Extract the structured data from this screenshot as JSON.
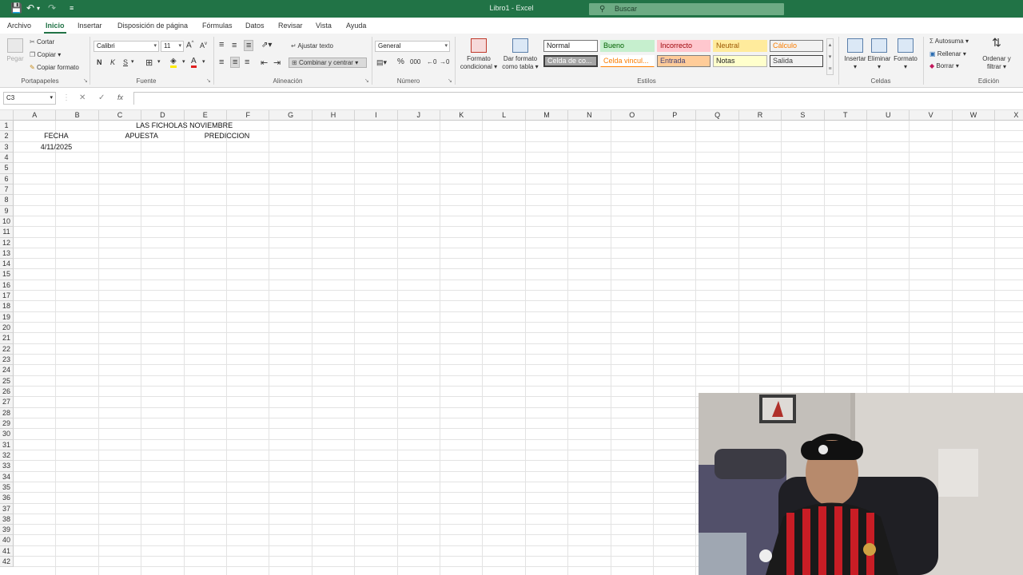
{
  "window": {
    "title": "Libro1  -  Excel",
    "search_placeholder": "Buscar"
  },
  "tabs": [
    "Archivo",
    "Inicio",
    "Insertar",
    "Disposición de página",
    "Fórmulas",
    "Datos",
    "Revisar",
    "Vista",
    "Ayuda"
  ],
  "active_tab": "Inicio",
  "clipboard": {
    "paste": "Pegar",
    "cut": "Cortar",
    "copy": "Copiar",
    "format_painter": "Copiar formato",
    "label": "Portapapeles"
  },
  "font": {
    "name": "Calibri",
    "size": "11",
    "bold": "N",
    "italic": "K",
    "underline": "S",
    "label": "Fuente"
  },
  "alignment": {
    "wrap": "Ajustar texto",
    "merge": "Combinar y centrar",
    "label": "Alineación"
  },
  "number": {
    "format": "General",
    "label": "Número"
  },
  "styles": {
    "cond_format": "Formato condicional",
    "as_table": "Dar formato como tabla",
    "normal": "Normal",
    "bueno": "Bueno",
    "incorrecto": "Incorrecto",
    "neutral": "Neutral",
    "calculo": "Cálculo",
    "celda_co": "Celda de co...",
    "celda_vinc": "Celda vincul...",
    "entrada": "Entrada",
    "notas": "Notas",
    "salida": "Salida",
    "label": "Estilos"
  },
  "cells_group": {
    "insert": "Insertar",
    "delete": "Eliminar",
    "format": "Formato",
    "label": "Celdas"
  },
  "editing": {
    "autosum": "Autosuma",
    "fill": "Rellenar",
    "clear": "Borrar",
    "sort": "Ordenar y filtrar",
    "label": "Edición"
  },
  "formula_bar": {
    "name_box": "C3",
    "fx": "fx"
  },
  "columns": [
    "A",
    "B",
    "C",
    "D",
    "E",
    "F",
    "G",
    "H",
    "I",
    "J",
    "K",
    "L",
    "M",
    "N",
    "O",
    "P",
    "Q",
    "R",
    "S",
    "T",
    "U",
    "V",
    "W",
    "X"
  ],
  "rows": [
    "1",
    "2",
    "3",
    "4",
    "5",
    "6",
    "7",
    "8",
    "9",
    "10",
    "11",
    "12",
    "13",
    "14",
    "15",
    "16",
    "17",
    "18",
    "19",
    "20",
    "21",
    "22",
    "23",
    "24",
    "25",
    "26",
    "27",
    "28",
    "29",
    "30",
    "31",
    "32",
    "33",
    "34",
    "35",
    "36",
    "37",
    "38",
    "39",
    "40",
    "41",
    "42"
  ],
  "sheet": {
    "title": "LAS FICHOLAS NOVIEMBRE",
    "fecha": "FECHA",
    "apuesta": "APUESTA",
    "prediccion": "PREDICCION",
    "date": "4/11/2025"
  }
}
